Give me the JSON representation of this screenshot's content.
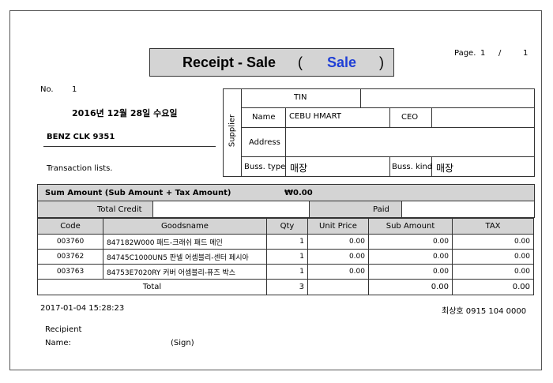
{
  "title": {
    "main": "Receipt - Sale",
    "paren_open": "(",
    "kind": "Sale",
    "paren_close": ")"
  },
  "page": {
    "label": "Page.",
    "current": "1",
    "separator": "/",
    "total": "1"
  },
  "receipt": {
    "no_label": "No.",
    "no_value": "1",
    "date_ko": "2016년 12월 28일 수요일",
    "customer": "BENZ CLK 9351",
    "transaction_label": "Transaction lists."
  },
  "supplier": {
    "side_label": "Supplier",
    "tin_label": "TIN",
    "tin_value": "",
    "name_label": "Name",
    "name_value": "CEBU HMART",
    "ceo_label": "CEO",
    "ceo_value": "",
    "address_label": "Address",
    "address_value": "",
    "buss_type_label": "Buss. type",
    "buss_type_value": "매장",
    "buss_kind_label": "Buss. kind",
    "buss_kind_value": "매장"
  },
  "summary": {
    "label": "Sum Amount (Sub Amount + Tax Amount)",
    "value": "₩0.00",
    "credit_label": "Total Credit",
    "credit_value": "",
    "paid_label": "Paid",
    "paid_value": ""
  },
  "table": {
    "headers": {
      "code": "Code",
      "name": "Goodsname",
      "qty": "Qty",
      "unit": "Unit Price",
      "sub": "Sub Amount",
      "tax": "TAX"
    },
    "rows": [
      {
        "code": "003760",
        "name": "847182W000 패드-크래쉬 패드 메인",
        "qty": "1",
        "unit": "0.00",
        "sub": "0.00",
        "tax": "0.00"
      },
      {
        "code": "003762",
        "name": "84745C1000UN5 판넬 어셈블리-센터 페시아",
        "qty": "1",
        "unit": "0.00",
        "sub": "0.00",
        "tax": "0.00"
      },
      {
        "code": "003763",
        "name": "84753E7020RY 커버 어셈블리-퓨즈 박스",
        "qty": "1",
        "unit": "0.00",
        "sub": "0.00",
        "tax": "0.00"
      }
    ],
    "total": {
      "label": "Total",
      "qty": "3",
      "unit": "",
      "sub": "0.00",
      "tax": "0.00"
    }
  },
  "footer": {
    "timestamp": "2017-01-04 15:28:23",
    "contact": "최상호 0915 104 0000",
    "recipient_label": "Recipient",
    "name_label": "Name:",
    "sign_label": "(Sign)"
  }
}
